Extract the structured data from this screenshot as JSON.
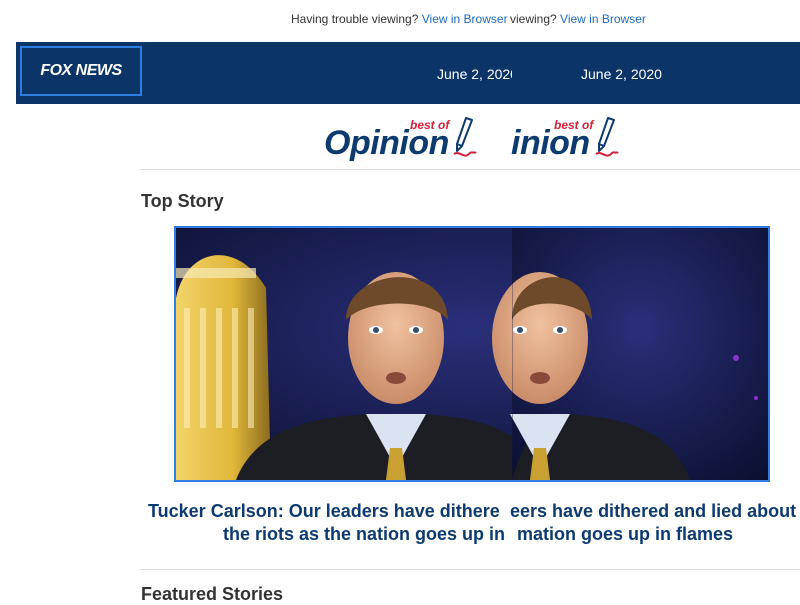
{
  "preheader": {
    "text": "Having trouble viewing?",
    "link": "View in Browser",
    "dup_text": "viewing?",
    "dup_link": "View in Browser"
  },
  "header": {
    "logo": "FOX NEWS",
    "date": "June 2, 2020",
    "date_partial": "June 2, 202"
  },
  "opinion_brand": {
    "word": "Opinion",
    "word_partial": "inion",
    "best_of": "best of"
  },
  "top_story": {
    "section_title": "Top Story",
    "headline_line1": "Tucker Carlson: Our leaders have dithere",
    "headline_line1_dup": "eers have dithered and lied about",
    "headline_line2": "the riots as the nation goes up in",
    "headline_line2_dup": "mation goes up in flames"
  },
  "featured": {
    "section_title": "Featured Stories"
  },
  "colors": {
    "navy": "#0b3567",
    "brand_blue": "#2f7de1",
    "headline_blue": "#0d3b70",
    "accent_red": "#d2223a",
    "link_blue": "#1f6bb8"
  }
}
